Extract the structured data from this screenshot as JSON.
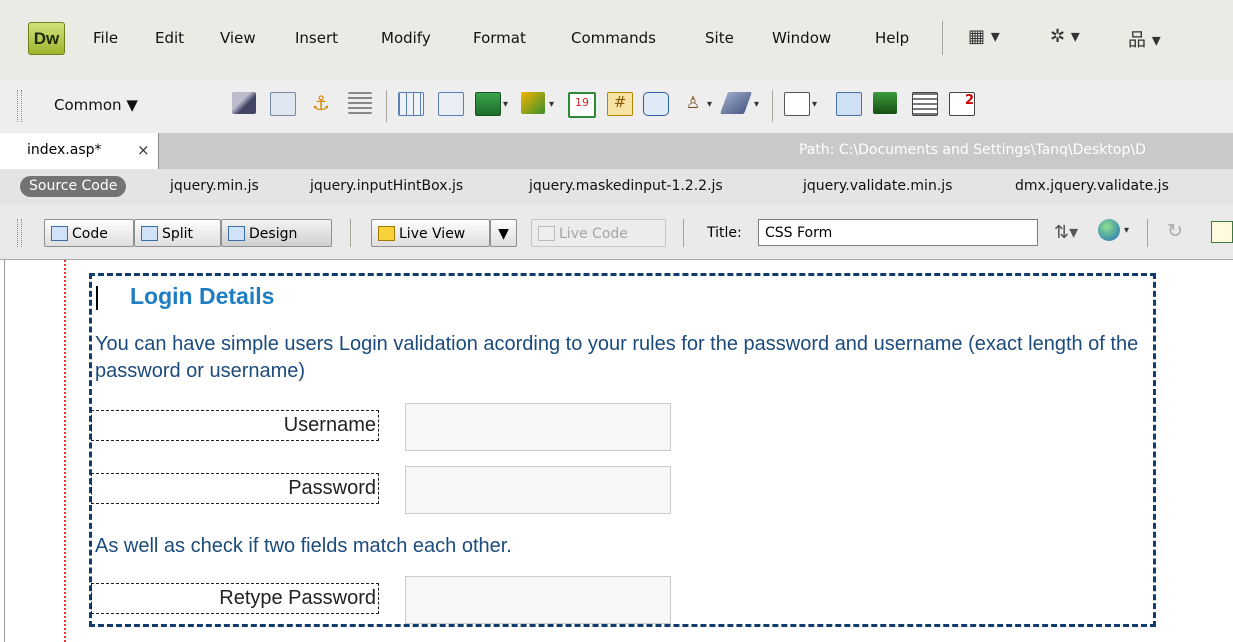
{
  "app": {
    "logo": "Dw"
  },
  "menu": [
    "File",
    "Edit",
    "View",
    "Insert",
    "Modify",
    "Format",
    "Commands",
    "Site",
    "Window",
    "Help"
  ],
  "menu_tools": [
    "layout-icon",
    "gear-icon",
    "site-icon"
  ],
  "insert_bar": {
    "category": "Common"
  },
  "document_tab": {
    "name": "index.asp*",
    "close": "×",
    "path": "Path:  C:\\Documents and Settings\\Tanq\\Desktop\\D"
  },
  "related_files": {
    "source": "Source Code",
    "files": [
      "jquery.min.js",
      "jquery.inputHintBox.js",
      "jquery.maskedinput-1.2.2.js",
      "jquery.validate.min.js",
      "dmx.jquery.validate.js"
    ]
  },
  "doc_toolbar": {
    "code": "Code",
    "split": "Split",
    "design": "Design",
    "live_view": "Live View",
    "live_code": "Live Code",
    "title_label": "Title:",
    "title_value": "CSS Form"
  },
  "form": {
    "heading": "Login Details",
    "description": "You can have simple users Login validation acording to your rules for the password and username (exact length of the password or username)",
    "username_label": "Username",
    "password_label": "Password",
    "match_text": "As well as check if two fields match each other.",
    "retype_label": "Retype Password"
  },
  "colors": {
    "heading": "#1f7ec2",
    "text": "#1b4b7d",
    "form_border": "#123c6e"
  }
}
